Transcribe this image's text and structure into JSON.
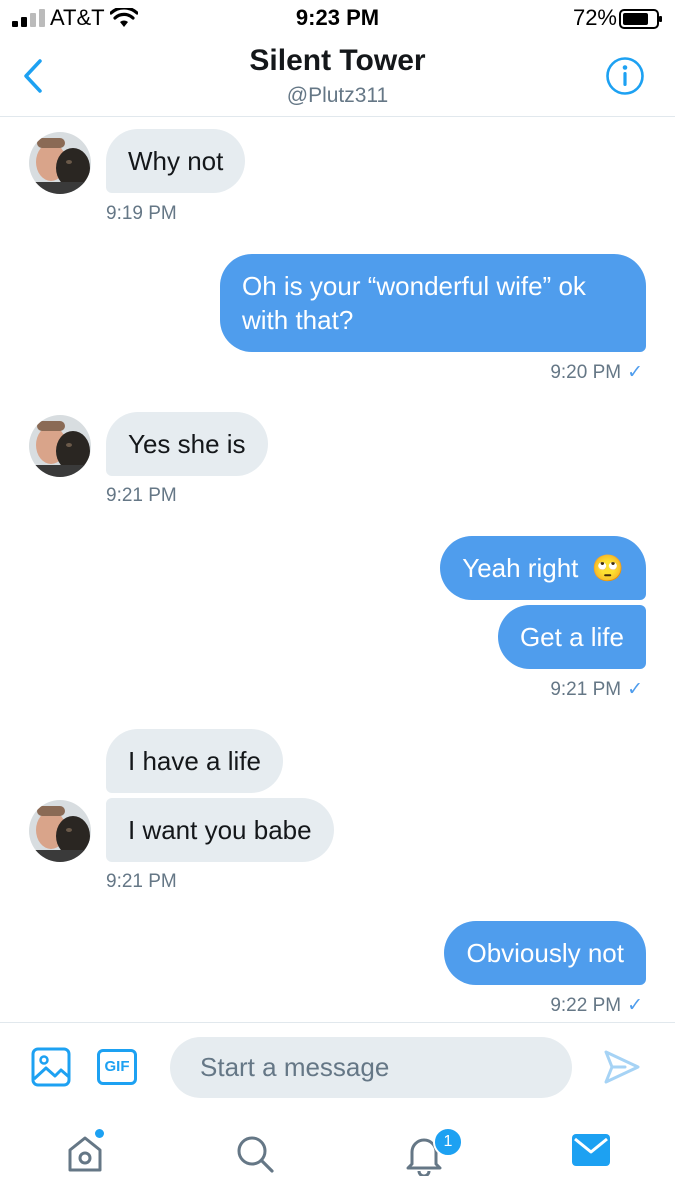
{
  "status_bar": {
    "carrier": "AT&T",
    "time": "9:23 PM",
    "battery": "72%"
  },
  "header": {
    "title": "Silent Tower",
    "handle": "@Plutz311"
  },
  "messages": [
    {
      "dir": "in",
      "text": "Why not",
      "time": "9:19 PM"
    },
    {
      "dir": "out",
      "text": "Oh is your “wonderful wife” ok with that?",
      "time": "9:20 PM"
    },
    {
      "dir": "in",
      "text": "Yes she is",
      "time": "9:21 PM"
    },
    {
      "dir": "out",
      "text": "Yeah right",
      "emoji": "🙄",
      "text2": "Get a life",
      "time": "9:21 PM"
    },
    {
      "dir": "in",
      "text": "I have a life",
      "text2": "I want you babe",
      "time": "9:21 PM"
    },
    {
      "dir": "out",
      "text": "Obviously not",
      "time": "9:22 PM"
    }
  ],
  "composer": {
    "placeholder": "Start a message",
    "gif_label": "GIF"
  },
  "tabbar": {
    "notifications_badge": "1"
  },
  "colors": {
    "accent": "#4f9ded",
    "incoming_bubble": "#e6ecf0",
    "muted": "#657786"
  },
  "icons": [
    "back-arrow-icon",
    "info-icon",
    "image-icon",
    "gif-icon",
    "send-icon",
    "home-icon",
    "search-icon",
    "bell-icon",
    "mail-icon"
  ]
}
